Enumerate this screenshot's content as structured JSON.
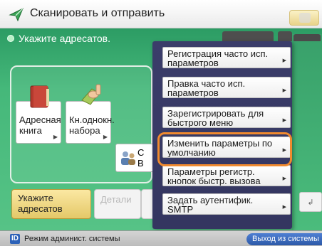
{
  "window": {
    "title": "Сканировать и отправить",
    "instruction": "Укажите адресатов."
  },
  "tiles": [
    {
      "label": "Адресная книга",
      "icon": "address-book-icon"
    },
    {
      "label": "Кн.однокн. набора",
      "icon": "one-touch-icon"
    }
  ],
  "partial_tile_letter": "С",
  "partial_tile_letter2": "В",
  "bottom_row": {
    "specify": "Укажите адресатов",
    "details": "Детали",
    "chip_letters": "У а"
  },
  "menu": {
    "items": [
      {
        "label": "Регистрация часто исп. параметров"
      },
      {
        "label": "Правка часто исп. параметров"
      },
      {
        "label": "Зарегистрировать для быстрого меню"
      },
      {
        "label": "Изменить параметры по умолчанию",
        "highlighted": true
      },
      {
        "label": "Параметры регистр. кнопок быстр. вызова"
      },
      {
        "label": "Задать аутентифик. SMTP"
      }
    ]
  },
  "status_bar": {
    "admin_icon": "ID",
    "admin_text": "Режим админист. системы",
    "logout": "Выход из системы"
  },
  "colors": {
    "panel_green": "#45b87a",
    "menu_bg": "#3b3d6a",
    "highlight": "#f08a2f",
    "logout_blue": "#2c59a8"
  }
}
